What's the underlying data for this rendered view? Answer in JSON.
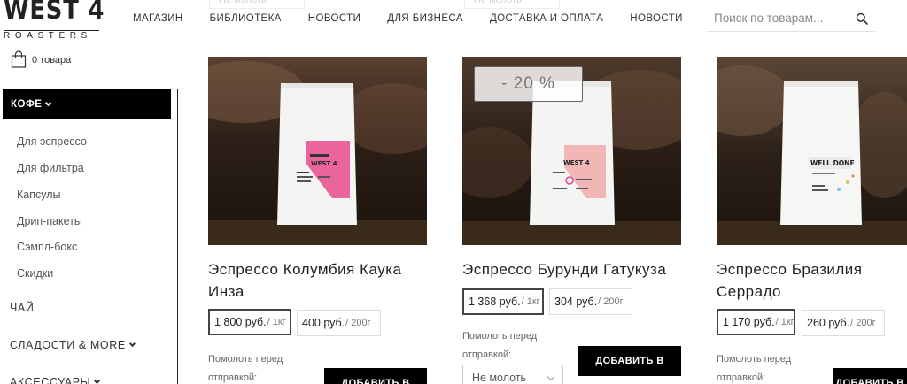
{
  "header": {
    "logo_main": "WEST 4",
    "logo_sub": "ROASTERS",
    "nav": [
      "Магазин",
      "Библиотека",
      "Новости",
      "Для бизнеса",
      "Доставка и оплата",
      "Новости"
    ],
    "search_placeholder": "Поиск по товарам...",
    "cart_label": "0 товара",
    "ghost_select_1": "Не молоть",
    "ghost_select_2": "Не молоть"
  },
  "sidebar": {
    "active_category": "Кофе",
    "subitems": [
      "Для эспрессо",
      "Для фильтра",
      "Капсулы",
      "Дрип-пакеты",
      "Сэмпл-бокс",
      "Скидки"
    ],
    "categories": [
      "Чай",
      "Сладости & more",
      "Аксессуары"
    ]
  },
  "products": [
    {
      "title_line1": "Эспрессо Колумбия Каука",
      "title_line2": "Инза",
      "price_main": "1 800 руб.",
      "unit_main": "/ 1кг",
      "price_alt": "400 руб.",
      "unit_alt": "/ 200г",
      "grind_label": "Помолоть перед отправкой:",
      "add_label": "Добавить в",
      "pack_brand": "WEST 4",
      "pack_accent": "#e64b8c"
    },
    {
      "badge": "- 20 %",
      "title_line1": "Эспрессо Бурунди Гатукуза",
      "title_line2": "",
      "price_main": "1 368 руб.",
      "unit_main": "/ 1кг",
      "price_alt": "304 руб.",
      "unit_alt": "/ 200г",
      "grind_label": "Помолоть перед отправкой:",
      "grind_value": "Не молоть",
      "add_label": "Добавить в",
      "pack_brand": "WEST 4",
      "pack_accent": "#f0a7a7"
    },
    {
      "title_line1": "Эспрессо Бразилия",
      "title_line2": "Серрадо",
      "price_main": "1 170 руб.",
      "unit_main": "/ 1кг",
      "price_alt": "260 руб.",
      "unit_alt": "/ 200г",
      "grind_label": "Помолоть перед отправкой:",
      "add_label": "Добавить в",
      "pack_brand": "WELL DONE",
      "pack_accent": "#d9c84a"
    }
  ],
  "icons": {
    "search": "search-icon",
    "cart": "shopping-bag-icon",
    "chevron": "chevron-down-icon"
  }
}
